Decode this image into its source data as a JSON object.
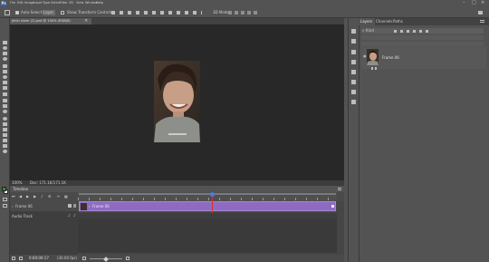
{
  "app": {
    "logo": "Ps"
  },
  "menu": [
    "File",
    "Edit",
    "Image",
    "Layer",
    "Type",
    "Select",
    "Filter",
    "3D",
    "View",
    "Window",
    "Help"
  ],
  "options_bar": {
    "auto_select_label": "Auto-Select:",
    "auto_select_value": "Layer",
    "show_transform_label": "Show Transform Controls",
    "mode_label": "3D Mode:"
  },
  "document": {
    "tab_title": "jimin silver (2).psd @ 100% (RGB/8)",
    "tab_close": "×",
    "zoom": "100%",
    "doc_info": "Doc: 171.1K/171.1K"
  },
  "timeline": {
    "title": "Timeline",
    "clip_label": "Frame 06",
    "track_label": "Frame 06",
    "audio_label": "Audio Track",
    "timecode": "0:00:00:17",
    "fps": "(30.00 fps)"
  },
  "panels": {
    "tabs": [
      "Layers",
      "Channels",
      "Paths"
    ],
    "kind_label": "Kind",
    "layer_name": "Frame 06"
  },
  "colors": {
    "workspace": "#535353",
    "canvas_bg": "#282828",
    "clip": "#8e6bc0",
    "playhead": "#d23030",
    "current_time_marker": "#4a7ce0"
  }
}
